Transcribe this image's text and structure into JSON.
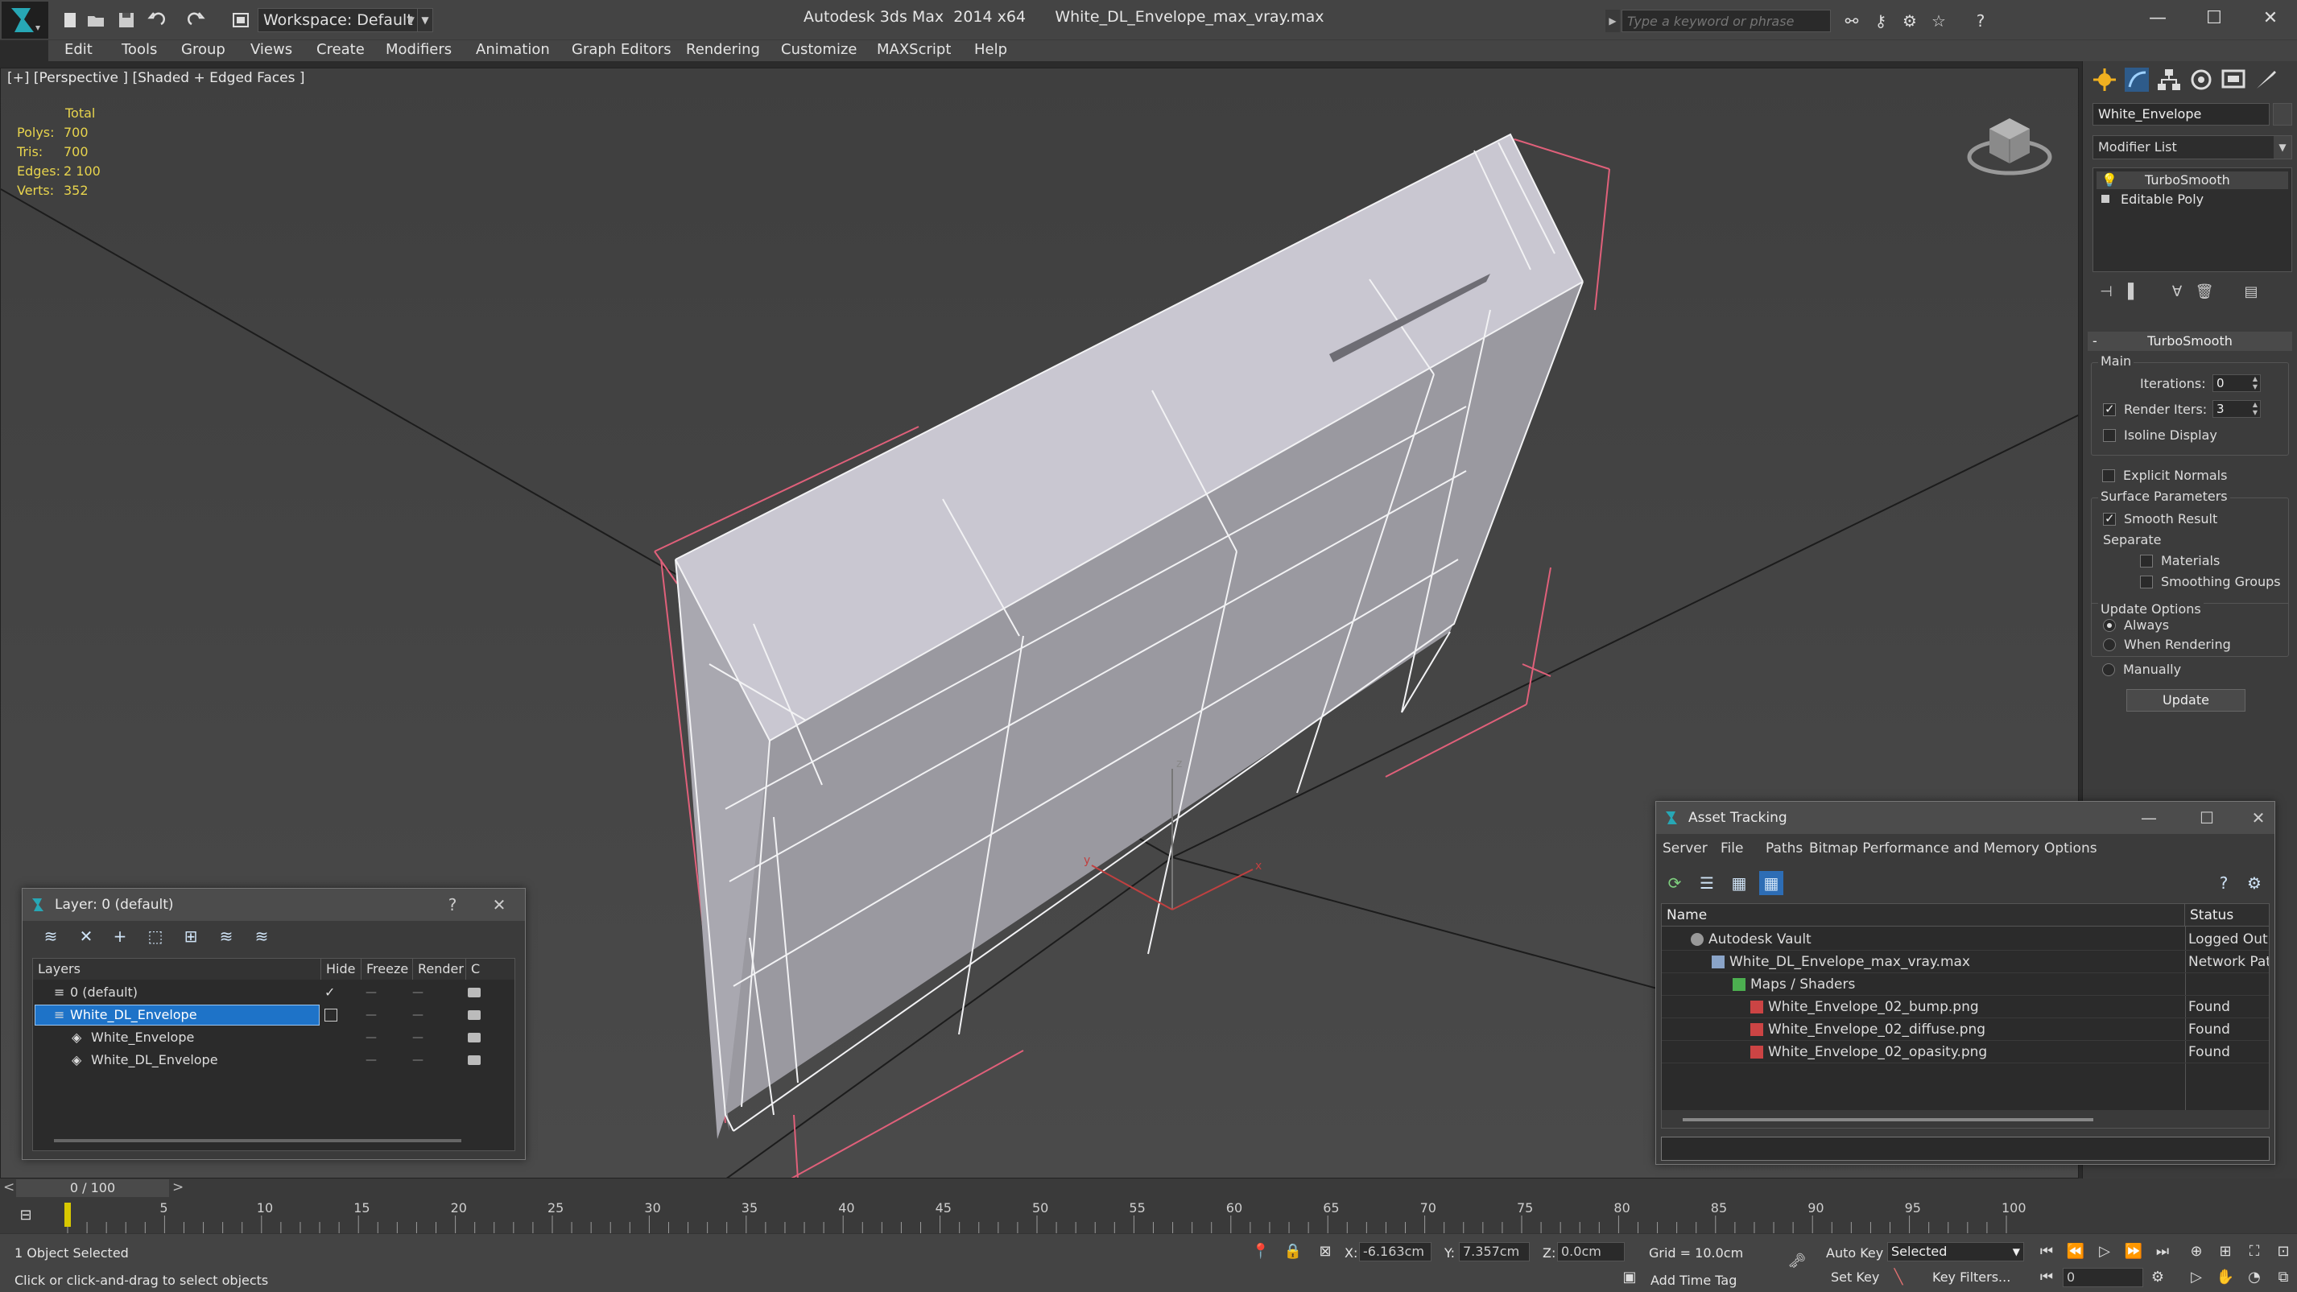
{
  "titlebar": {
    "workspace": "Workspace: Default",
    "app_title": "Autodesk 3ds Max  2014 x64",
    "file_title": "White_DL_Envelope_max_vray.max",
    "search_placeholder": "Type a keyword or phrase"
  },
  "menu": [
    "Edit",
    "Tools",
    "Group",
    "Views",
    "Create",
    "Modifiers",
    "Animation",
    "Graph Editors",
    "Rendering",
    "Customize",
    "MAXScript",
    "Help"
  ],
  "viewport": {
    "label": "[+] [Perspective ] [Shaded + Edged Faces ]",
    "stats": {
      "total": "Total",
      "rows": [
        {
          "label": "Polys:",
          "value": "700"
        },
        {
          "label": "Tris:",
          "value": "700"
        },
        {
          "label": "Edges:",
          "value": "2 100"
        },
        {
          "label": "Verts:",
          "value": "352"
        }
      ]
    },
    "gizmo_axes": [
      "x",
      "y",
      "z"
    ]
  },
  "command_panel": {
    "object_name": "White_Envelope",
    "modifier_list": "Modifier List",
    "stack": [
      "TurboSmooth",
      "Editable Poly"
    ],
    "rollout": "TurboSmooth",
    "main_group": "Main",
    "iterations_label": "Iterations:",
    "iterations_value": "0",
    "render_iters_label": "Render Iters:",
    "render_iters_value": "3",
    "isoline": "Isoline Display",
    "explicit_normals": "Explicit Normals",
    "surface_group": "Surface Parameters",
    "smooth_result": "Smooth Result",
    "separate": "Separate",
    "materials": "Materials",
    "smoothing_groups": "Smoothing Groups",
    "update_group": "Update Options",
    "always": "Always",
    "when_rendering": "When Rendering",
    "manually": "Manually",
    "update_button": "Update"
  },
  "layer_dialog": {
    "title": "Layer: 0 (default)",
    "help": "?",
    "columns": [
      "Layers",
      "Hide",
      "Freeze",
      "Render",
      "C"
    ],
    "rows": [
      {
        "name": "0 (default)"
      },
      {
        "name": "White_DL_Envelope"
      },
      {
        "name": "White_Envelope"
      },
      {
        "name": "White_DL_Envelope"
      }
    ]
  },
  "asset_dialog": {
    "title": "Asset Tracking",
    "menu": [
      "Server",
      "File",
      "Paths",
      "Bitmap Performance and Memory",
      "Options"
    ],
    "columns": [
      "Name",
      "Status"
    ],
    "rows": [
      {
        "name": "Autodesk Vault",
        "status": "Logged Out"
      },
      {
        "name": "White_DL_Envelope_max_vray.max",
        "status": "Network Pat"
      },
      {
        "name": "Maps / Shaders",
        "status": ""
      },
      {
        "name": "White_Envelope_02_bump.png",
        "status": "Found"
      },
      {
        "name": "White_Envelope_02_diffuse.png",
        "status": "Found"
      },
      {
        "name": "White_Envelope_02_opasity.png",
        "status": "Found"
      }
    ]
  },
  "timeline": {
    "frame_label": "0 / 100",
    "ticks": [
      "5",
      "10",
      "15",
      "20",
      "25",
      "30",
      "35",
      "40",
      "45",
      "50",
      "55",
      "60",
      "65",
      "70",
      "75",
      "80",
      "85",
      "90",
      "95",
      "100"
    ]
  },
  "status": {
    "selection": "1 Object Selected",
    "prompt": "Click or click-and-drag to select objects",
    "x_label": "X:",
    "x_value": "-6.163cm",
    "y_label": "Y:",
    "y_value": "7.357cm",
    "z_label": "Z:",
    "z_value": "0.0cm",
    "grid": "Grid = 10.0cm",
    "auto_key": "Auto Key",
    "selected": "Selected",
    "set_key": "Set Key",
    "key_filters": "Key Filters...",
    "add_time_tag": "Add Time Tag",
    "frame_value": "0"
  },
  "colors": {
    "accent_blue": "#1e73c8",
    "stats_yellow": "#e8d44d",
    "wire": "#e6e6ea",
    "pink_bbox": "#e0607a"
  }
}
